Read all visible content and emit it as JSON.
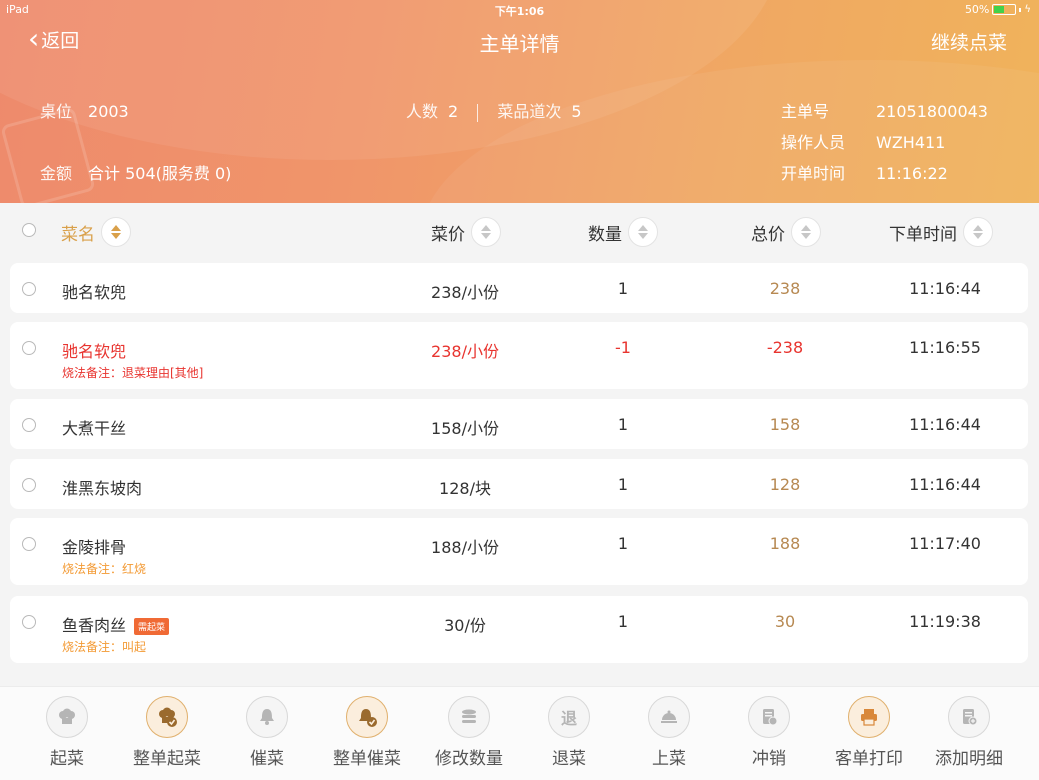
{
  "status_bar": {
    "device": "iPad",
    "time": "下午1:06",
    "battery": "50%",
    "battery_level": 0.5
  },
  "nav": {
    "back_label": "返回",
    "title": "主单详情",
    "continue_label": "继续点菜"
  },
  "order": {
    "table_label": "桌位",
    "table_value": "2003",
    "amount_label": "金额",
    "amount_value": "合计 504(服务费 0)",
    "people_label": "人数",
    "people_value": "2",
    "dish_count_label": "菜品道次",
    "dish_count_value": "5",
    "order_no_label": "主单号",
    "order_no_value": "21051800043",
    "operator_label": "操作人员",
    "operator_value": "WZH411",
    "open_time_label": "开单时间",
    "open_time_value": "11:16:22"
  },
  "columns": {
    "name": "菜名",
    "price": "菜价",
    "qty": "数量",
    "total": "总价",
    "time": "下单时间"
  },
  "items": [
    {
      "name": "驰名软兜",
      "price": "238/小份",
      "qty": "1",
      "total": "238",
      "time": "11:16:44",
      "note": "",
      "tag": "",
      "returned": false
    },
    {
      "name": "驰名软兜",
      "price": "238/小份",
      "qty": "-1",
      "total": "-238",
      "time": "11:16:55",
      "note": "烧法备注：退菜理由[其他]",
      "tag": "",
      "returned": true
    },
    {
      "name": "大煮干丝",
      "price": "158/小份",
      "qty": "1",
      "total": "158",
      "time": "11:16:44",
      "note": "",
      "tag": "",
      "returned": false
    },
    {
      "name": "淮黑东坡肉",
      "price": "128/块",
      "qty": "1",
      "total": "128",
      "time": "11:16:44",
      "note": "",
      "tag": "",
      "returned": false
    },
    {
      "name": "金陵排骨",
      "price": "188/小份",
      "qty": "1",
      "total": "188",
      "time": "11:17:40",
      "note": "烧法备注：红烧",
      "tag": "",
      "returned": false
    },
    {
      "name": "鱼香肉丝",
      "price": "30/份",
      "qty": "1",
      "total": "30",
      "time": "11:19:38",
      "note": "烧法备注：叫起",
      "tag": "需起菜",
      "returned": false
    }
  ],
  "toolbar": [
    {
      "label": "起菜",
      "icon": "chef-hat-icon",
      "active": false
    },
    {
      "label": "整单起菜",
      "icon": "chef-hat-check-icon",
      "active": true
    },
    {
      "label": "催菜",
      "icon": "bell-icon",
      "active": false
    },
    {
      "label": "整单催菜",
      "icon": "bell-check-icon",
      "active": true
    },
    {
      "label": "修改数量",
      "icon": "stack-icon",
      "active": false
    },
    {
      "label": "退菜",
      "icon": "return-icon",
      "active": false
    },
    {
      "label": "上菜",
      "icon": "serve-cloche-icon",
      "active": false
    },
    {
      "label": "冲销",
      "icon": "void-doc-icon",
      "active": false
    },
    {
      "label": "客单打印",
      "icon": "printer-icon",
      "active": true
    },
    {
      "label": "添加明细",
      "icon": "add-detail-icon",
      "active": false
    }
  ],
  "colors": {
    "accent": "#d9a04a",
    "returned": "#e8342f",
    "note": "#f39a34",
    "total": "#b78952",
    "tag": "#f06a35"
  }
}
